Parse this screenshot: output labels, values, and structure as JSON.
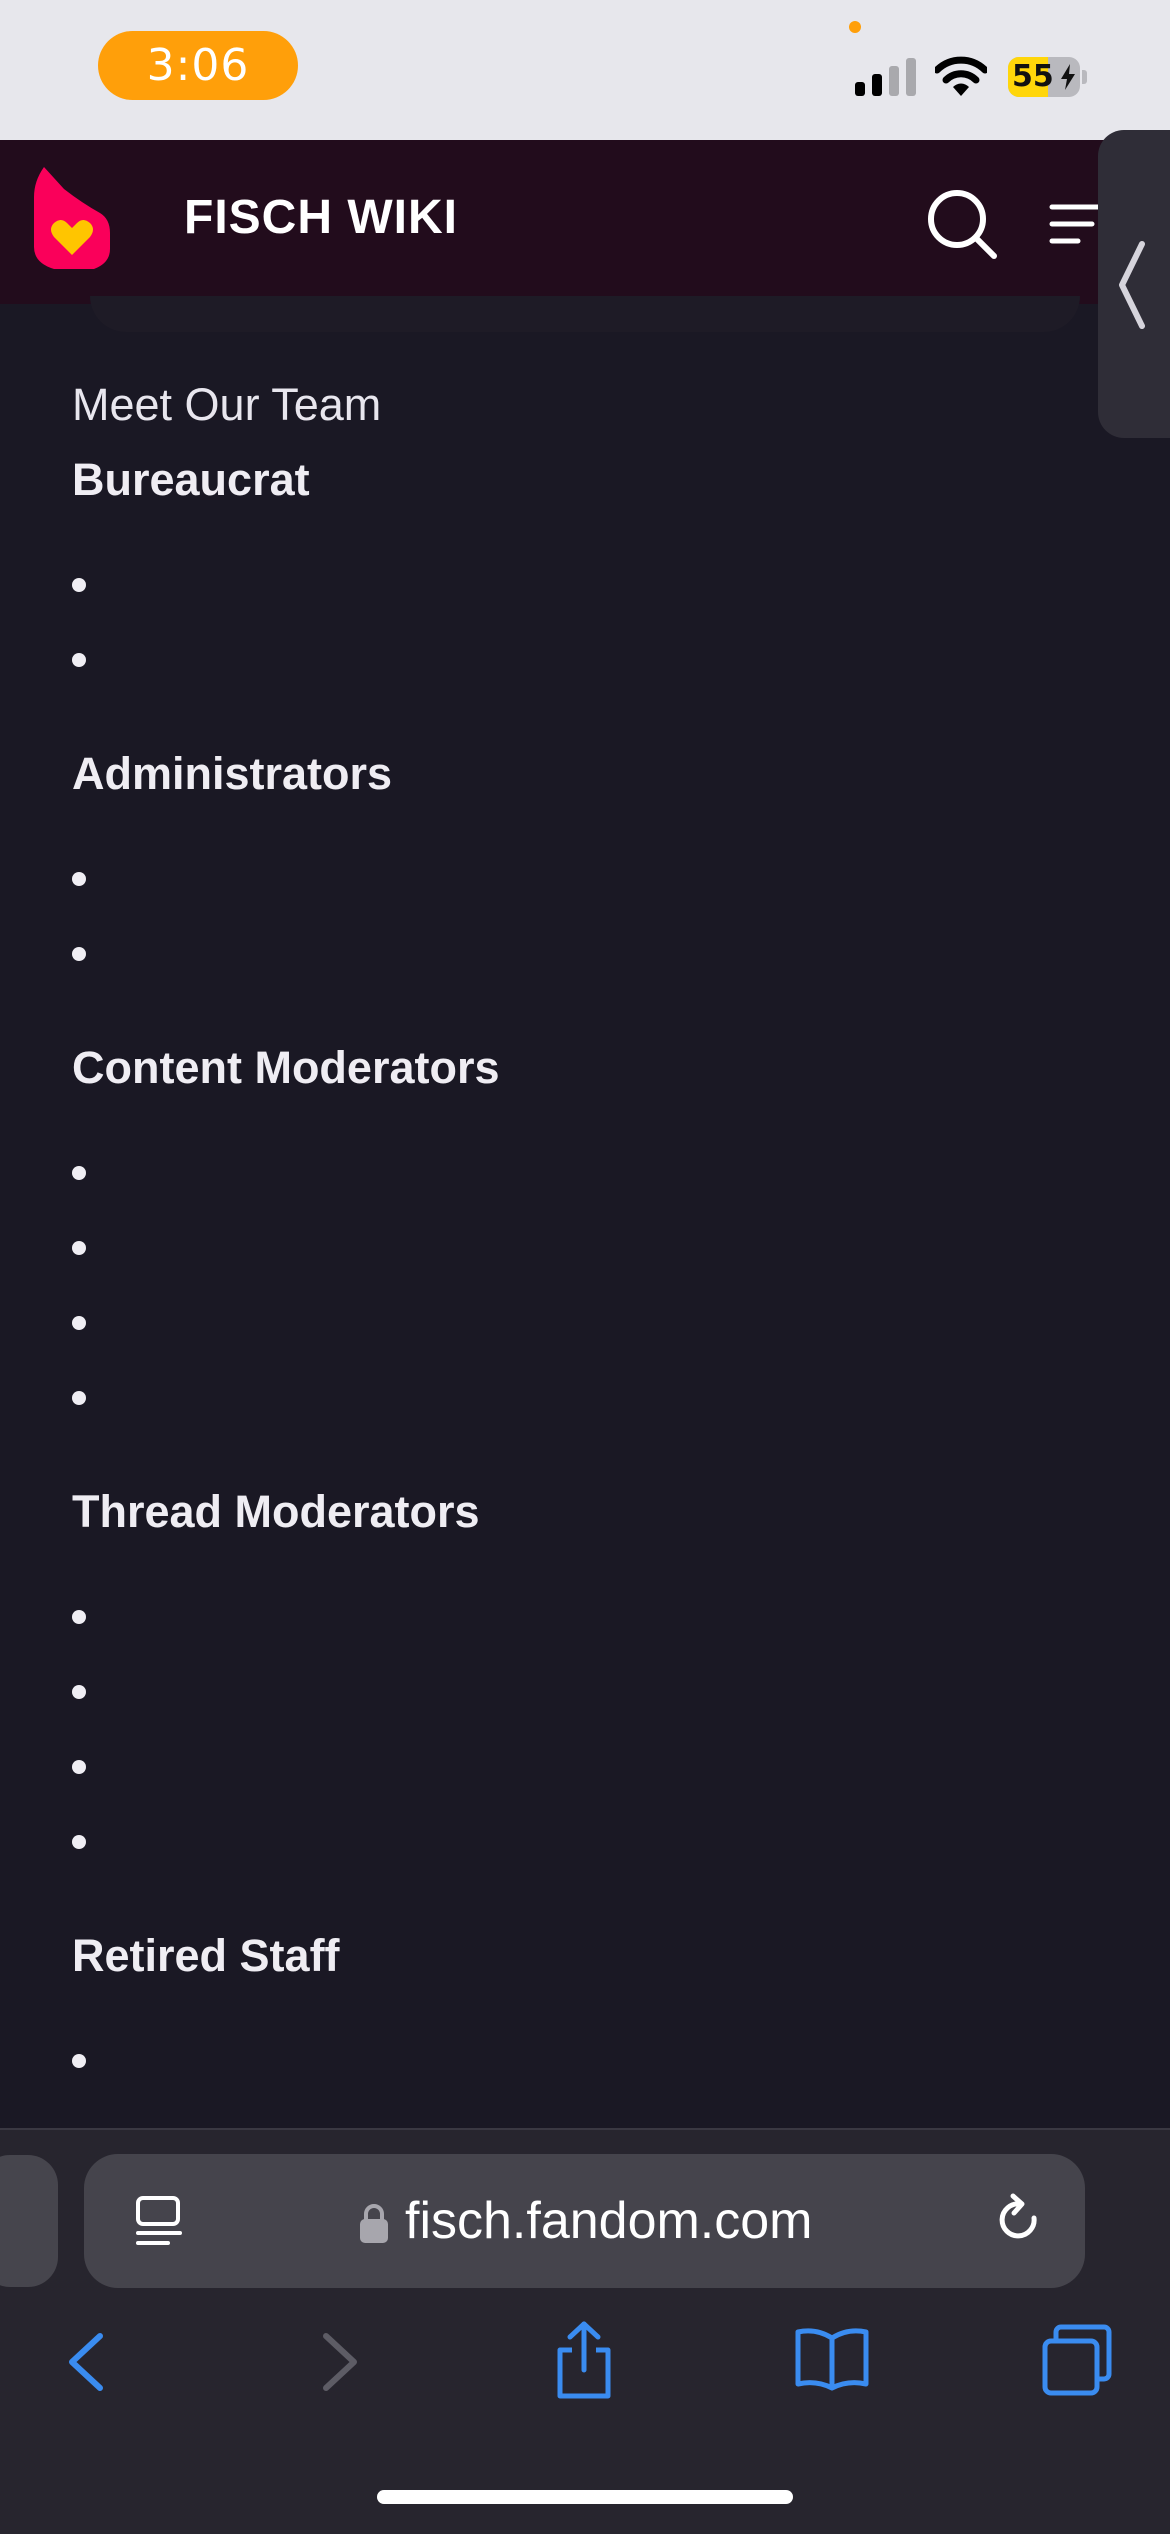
{
  "status_bar": {
    "time": "3:06",
    "battery_level": "55",
    "battery_fraction": 0.55,
    "colors": {
      "time_pill": "#ff9f0a",
      "battery_fill": "#ffd60a"
    }
  },
  "header": {
    "title": "FISCH WIKI",
    "icons": [
      "fandom-logo",
      "search-icon",
      "menu-icon",
      "chevron-left-icon"
    ],
    "colors": {
      "background": "#220c1c",
      "logo": "#fa005a",
      "logo_heart": "#ffc500"
    }
  },
  "content": {
    "intro": "Meet Our Team",
    "sections": [
      {
        "heading": "Bureaucrat",
        "items": [
          "",
          ""
        ]
      },
      {
        "heading": "Administrators",
        "items": [
          "",
          ""
        ]
      },
      {
        "heading": "Content Moderators",
        "items": [
          "",
          "",
          "",
          ""
        ]
      },
      {
        "heading": "Thread Moderators",
        "items": [
          "",
          "",
          "",
          ""
        ]
      },
      {
        "heading": "Retired Staff",
        "items": [
          "",
          "",
          ""
        ]
      }
    ]
  },
  "browser": {
    "url": "fisch.fandom.com",
    "accent_color": "#3a8cf0",
    "toolbar_icons": [
      "back-icon",
      "forward-icon",
      "share-icon",
      "bookmarks-icon",
      "tabs-icon"
    ]
  }
}
